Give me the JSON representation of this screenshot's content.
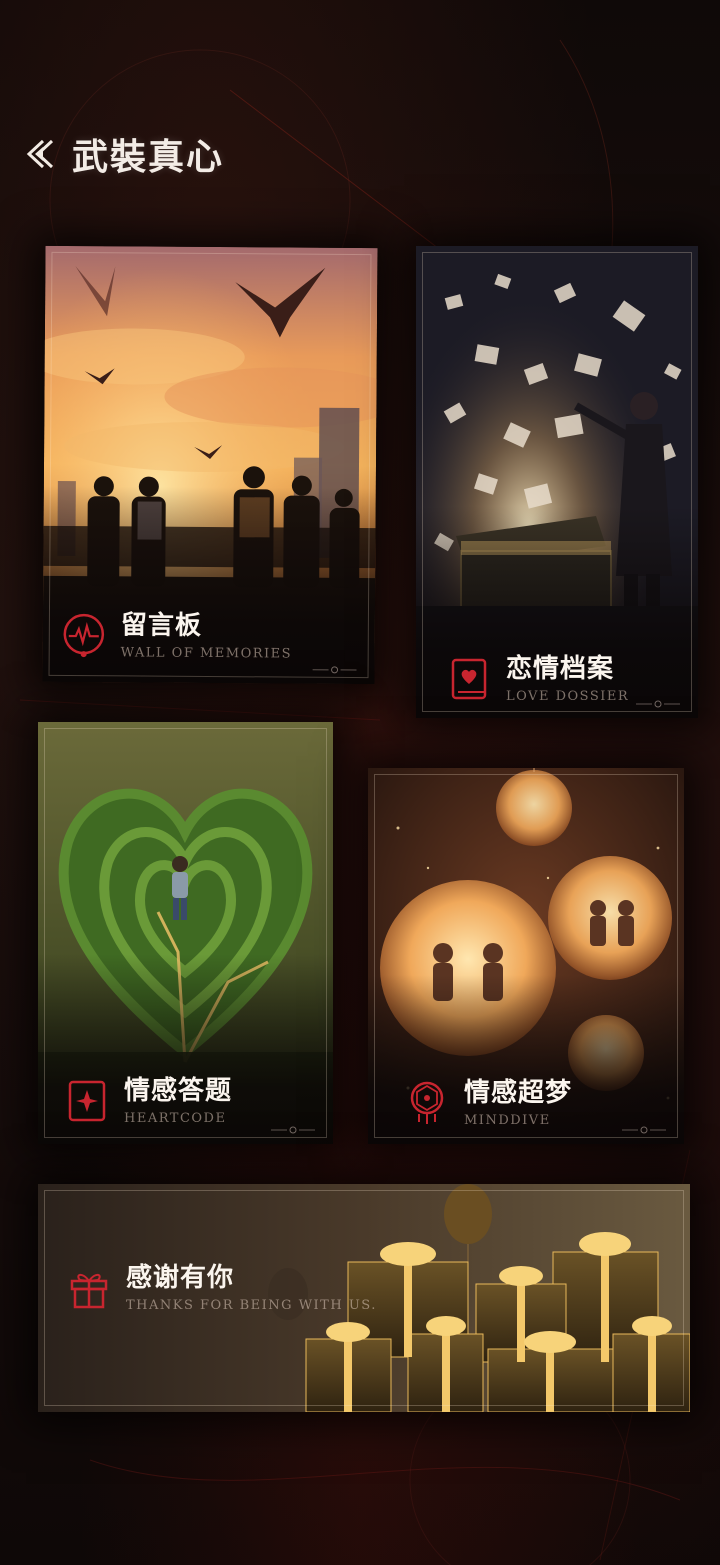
{
  "header": {
    "title": "武裝真心",
    "back_icon": "double-chevron-left-icon"
  },
  "colors": {
    "accent_red": "#c8252f",
    "text_light": "#fbf5ee",
    "background": "#120b0a"
  },
  "cards": {
    "wall": {
      "title": "留言板",
      "subtitle": "WALL OF MEMORIES",
      "icon": "heartbeat-circle-icon"
    },
    "love": {
      "title": "恋情档案",
      "subtitle": "LOVE DOSSIER",
      "icon": "heart-book-icon"
    },
    "heart": {
      "title": "情感答题",
      "subtitle": "HEARTCODE",
      "icon": "sparkle-card-icon"
    },
    "mind": {
      "title": "情感超梦",
      "subtitle": "MINDDIVE",
      "icon": "dreamcatcher-icon"
    },
    "thanks": {
      "title": "感谢有你",
      "subtitle": "THANKS FOR BEING WITH US.",
      "icon": "gift-box-icon"
    }
  }
}
